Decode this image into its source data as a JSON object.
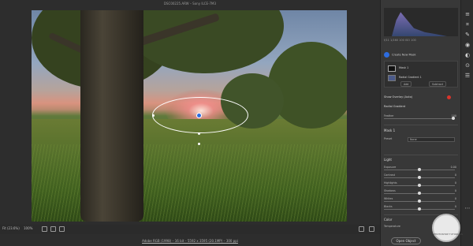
{
  "window": {
    "file_title": "DSC00225.ARW – Sony ILCE-7M3"
  },
  "canvas": {
    "zoom_label": "Fit (23.6%)",
    "zoom_percent": "100%",
    "footer_info": "Adobe RGB (1998) – 16 bit – 5592 x 3595 (20.1MP) – 300 ppi"
  },
  "panel": {
    "histogram_info": "f/11  1/160  100  ISO 100",
    "create_new_mask": "Create New Mask",
    "mask_1_label": "Mask 1",
    "radial_gradient_sub": "Radial Gradient 1",
    "add_label": "Add",
    "subtract_label": "Subtract",
    "show_overlay_label": "Show Overlay (Auto)",
    "radial_gradient_label": "Radial Gradient",
    "feather_label": "Feather",
    "feather_value": "100",
    "mask1_section": "Mask 1",
    "preset_label": "Preset",
    "preset_value": "None",
    "light_section": "Light",
    "sliders": [
      {
        "label": "Exposure",
        "value": "0.00",
        "pos": 0.5
      },
      {
        "label": "Contrast",
        "value": "0",
        "pos": 0.5
      },
      {
        "label": "Highlights",
        "value": "0",
        "pos": 0.5
      },
      {
        "label": "Shadows",
        "value": "0",
        "pos": 0.5
      },
      {
        "label": "Whites",
        "value": "0",
        "pos": 0.5
      },
      {
        "label": "Blacks",
        "value": "0",
        "pos": 0.5
      }
    ],
    "color_section": "Color",
    "temperature_label": "Temperature",
    "open_object_label": "Open Object"
  },
  "colors": {
    "accent": "#2d6cdf",
    "record": "#d9342b"
  },
  "toolbar_icons": [
    "edit-icon",
    "crop-icon",
    "heal-icon",
    "eye-icon",
    "mask-icon",
    "redeye-icon",
    "presets-icon",
    "more-icon"
  ],
  "watermark": {
    "text": "PHOTOSHOP TUTORIALS"
  }
}
